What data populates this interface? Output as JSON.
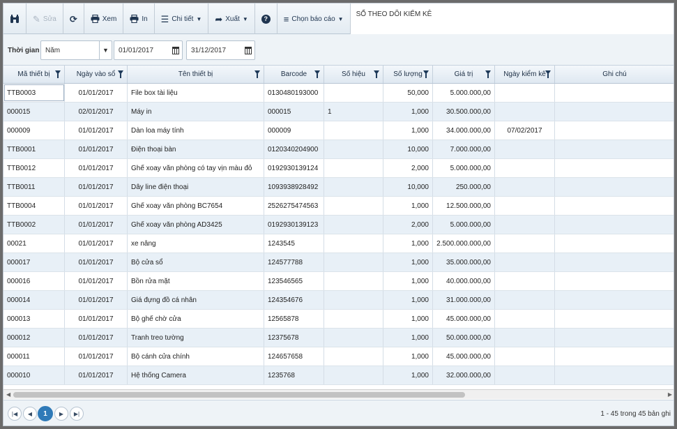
{
  "toolbar": {
    "edit_label": "Sửa",
    "view_label": "Xem",
    "print_label": "In",
    "detail_label": "Chi tiết",
    "export_label": "Xuất",
    "choose_report_label": "Chọn báo cáo",
    "report_title": "SỔ THEO DÕI KIỂM KÊ"
  },
  "filter": {
    "period_label": "Thời gian",
    "period_value": "Năm",
    "from_date": "01/01/2017",
    "to_date": "31/12/2017"
  },
  "grid": {
    "columns": [
      "Mã thiết bị",
      "Ngày vào sổ",
      "Tên thiết bị",
      "Barcode",
      "Số hiệu",
      "Số lượng",
      "Giá trị",
      "Ngày kiểm kê",
      "Ghi chú"
    ],
    "rows": [
      [
        "TTB0003",
        "01/01/2017",
        "File box tài liệu",
        "0130480193000",
        "",
        "50,000",
        "5.000.000,00",
        "",
        ""
      ],
      [
        "000015",
        "02/01/2017",
        "Máy in",
        "000015",
        "1",
        "1,000",
        "30.500.000,00",
        "",
        ""
      ],
      [
        "000009",
        "01/01/2017",
        "Dàn loa máy tính",
        "000009",
        "",
        "1,000",
        "34.000.000,00",
        "07/02/2017",
        ""
      ],
      [
        "TTB0001",
        "01/01/2017",
        "Điện thoại bàn",
        "0120340204900",
        "",
        "10,000",
        "7.000.000,00",
        "",
        ""
      ],
      [
        "TTB0012",
        "01/01/2017",
        "Ghế xoay văn phòng có tay vịn màu đỏ",
        "0192930139124",
        "",
        "2,000",
        "5.000.000,00",
        "",
        ""
      ],
      [
        "TTB0011",
        "01/01/2017",
        "Dây line điện thoại",
        "1093938928492",
        "",
        "10,000",
        "250.000,00",
        "",
        ""
      ],
      [
        "TTB0004",
        "01/01/2017",
        "Ghế xoay văn phòng BC7654",
        "2526275474563",
        "",
        "1,000",
        "12.500.000,00",
        "",
        ""
      ],
      [
        "TTB0002",
        "01/01/2017",
        "Ghế xoay văn phòng AD3425",
        "0192930139123",
        "",
        "2,000",
        "5.000.000,00",
        "",
        ""
      ],
      [
        "00021",
        "01/01/2017",
        "xe nâng",
        "1243545",
        "",
        "1,000",
        "2.500.000.000,00",
        "",
        ""
      ],
      [
        "000017",
        "01/01/2017",
        "Bộ cửa sổ",
        "124577788",
        "",
        "1,000",
        "35.000.000,00",
        "",
        ""
      ],
      [
        "000016",
        "01/01/2017",
        "Bồn rửa mặt",
        "123546565",
        "",
        "1,000",
        "40.000.000,00",
        "",
        ""
      ],
      [
        "000014",
        "01/01/2017",
        "Giá đựng đồ cá nhân",
        "124354676",
        "",
        "1,000",
        "31.000.000,00",
        "",
        ""
      ],
      [
        "000013",
        "01/01/2017",
        "Bộ ghế chờ cửa",
        "12565878",
        "",
        "1,000",
        "45.000.000,00",
        "",
        ""
      ],
      [
        "000012",
        "01/01/2017",
        "Tranh treo tường",
        "12375678",
        "",
        "1,000",
        "50.000.000,00",
        "",
        ""
      ],
      [
        "000011",
        "01/01/2017",
        "Bộ cánh cửa chính",
        "124657658",
        "",
        "1,000",
        "45.000.000,00",
        "",
        ""
      ],
      [
        "000010",
        "01/01/2017",
        "Hệ thống Camera",
        "1235768",
        "",
        "1,000",
        "32.000.000,00",
        "",
        ""
      ]
    ]
  },
  "pager": {
    "current_page": "1",
    "info": "1 - 45 trong 45 bản ghi"
  },
  "colors": {
    "accent": "#2f7ab8",
    "row_alt": "#e8f0f7",
    "header_text": "#1c2e44"
  },
  "icons": [
    "binoculars-icon",
    "pencil-icon",
    "refresh-icon",
    "printer-icon",
    "list-icon",
    "share-arrow-icon",
    "help-icon",
    "menu-icon",
    "calendar-icon",
    "filter-icon"
  ]
}
